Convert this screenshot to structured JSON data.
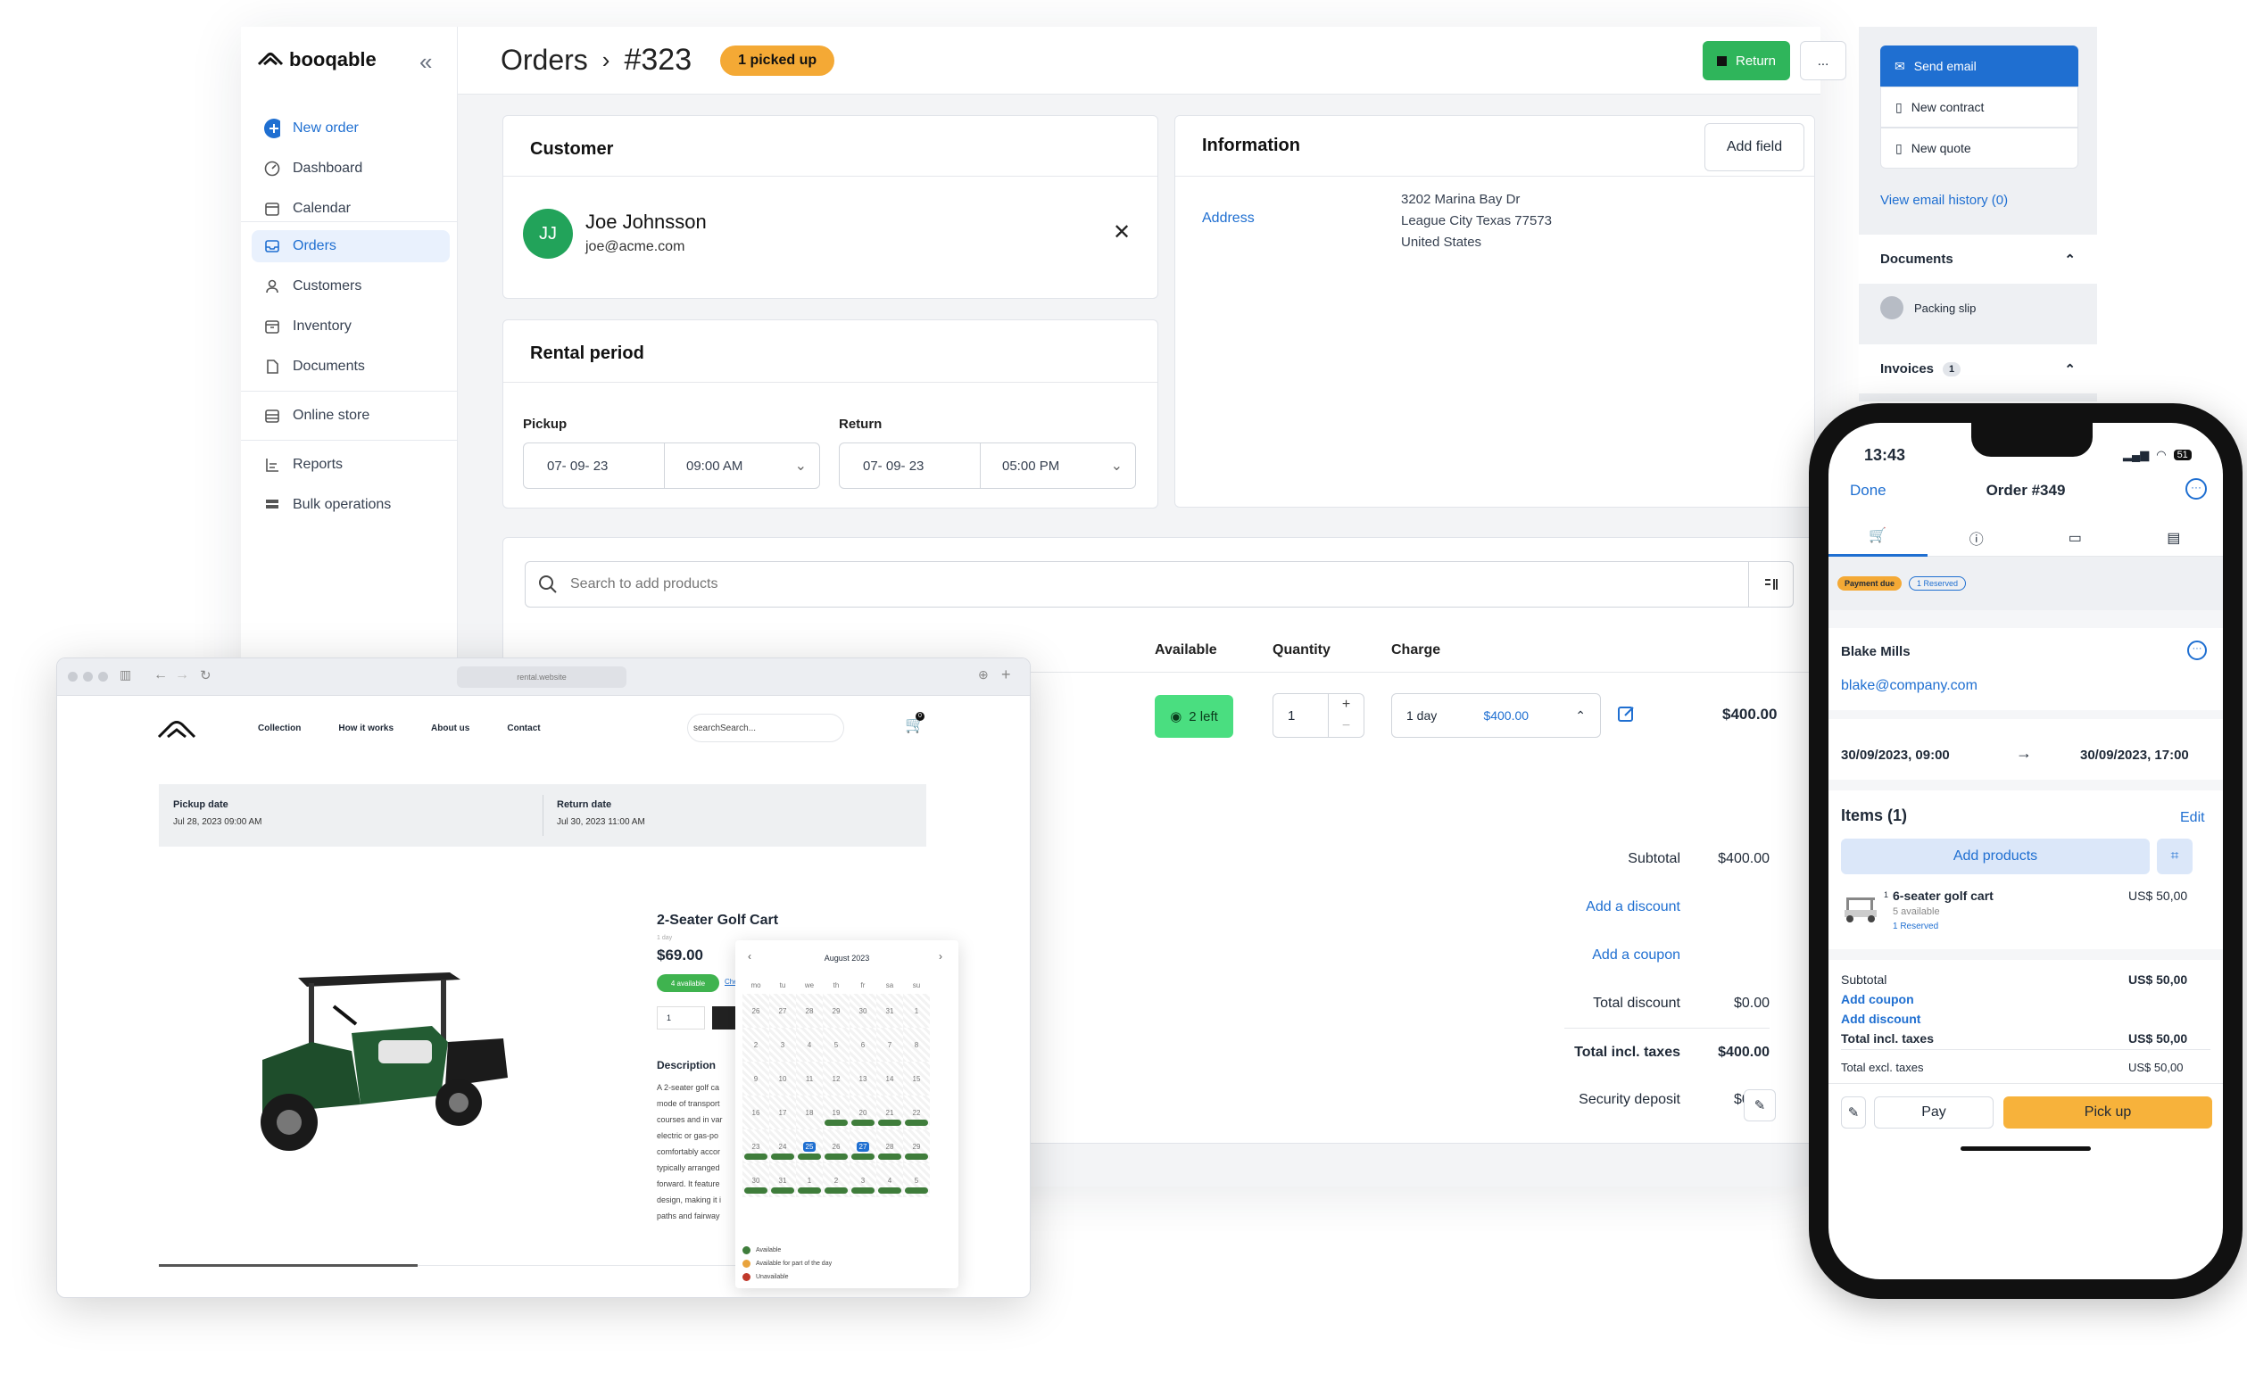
{
  "app": {
    "logo": "booqable",
    "nav": {
      "new_order": "New order",
      "dashboard": "Dashboard",
      "calendar": "Calendar",
      "orders": "Orders",
      "customers": "Customers",
      "inventory": "Inventory",
      "documents": "Documents",
      "online_store": "Online store",
      "reports": "Reports",
      "bulk_operations": "Bulk operations"
    },
    "header": {
      "title": "Orders",
      "order_number": "#323",
      "status_badge": "1 picked up",
      "return_button": "Return",
      "more_button": "..."
    },
    "customer": {
      "heading": "Customer",
      "initials": "JJ",
      "name": "Joe Johnsson",
      "email": "joe@acme.com"
    },
    "information": {
      "heading": "Information",
      "add_field": "Add field",
      "address_label": "Address",
      "address_line1": "3202 Marina Bay Dr",
      "address_line2": "League City Texas 77573",
      "address_line3": "United States"
    },
    "rental_period": {
      "heading": "Rental period",
      "pickup_label": "Pickup",
      "pickup_date": "07- 09- 23",
      "pickup_time": "09:00 AM",
      "return_label": "Return",
      "return_date": "07- 09- 23",
      "return_time": "05:00 PM"
    },
    "products": {
      "search_placeholder": "Search to add products",
      "col_available": "Available",
      "col_quantity": "Quantity",
      "col_charge": "Charge",
      "row": {
        "available": "2 left",
        "quantity": "1",
        "charge_period": "1 day",
        "charge_price": "$400.00",
        "total": "$400.00"
      }
    },
    "totals": {
      "subtotal_label": "Subtotal",
      "subtotal": "$400.00",
      "add_discount": "Add a discount",
      "add_coupon": "Add a coupon",
      "total_discount_label": "Total discount",
      "total_discount": "$0.00",
      "total_incl_label": "Total incl. taxes",
      "total_incl": "$400.00",
      "deposit_label": "Security deposit",
      "deposit": "$0.00"
    },
    "right_panel": {
      "send_email": "Send email",
      "new_contract": "New contract",
      "new_quote": "New quote",
      "email_history": "View email history (0)",
      "documents": "Documents",
      "packing_slip": "Packing slip",
      "invoices": "Invoices",
      "invoices_count": "1"
    }
  },
  "browser": {
    "url": "rental.website",
    "nav": [
      "Collection",
      "How it works",
      "About us",
      "Contact"
    ],
    "search_placeholder": "searchSearch...",
    "cart_count": "0",
    "pickup_label": "Pickup date",
    "pickup_value": "Jul 28, 2023 09:00 AM",
    "return_label": "Return date",
    "return_value": "Jul 30, 2023 11:00 AM",
    "product_title": "2-Seater Golf Cart",
    "price_period": "1 day",
    "price": "$69.00",
    "available_badge": "4 available",
    "check_link": "Che",
    "qty": "1",
    "description_heading": "Description",
    "description_lines": [
      "A 2-seater golf ca",
      "mode of transport",
      "courses and in var",
      "electric or gas-po",
      "comfortably accor",
      "typically arranged",
      "forward. It feature",
      "design, making it i",
      "paths and fairway"
    ],
    "calendar": {
      "month": "August 2023",
      "weekdays": [
        "mo",
        "tu",
        "we",
        "th",
        "fr",
        "sa",
        "su"
      ],
      "weeks": [
        [
          "26",
          "27",
          "28",
          "29",
          "30",
          "31",
          "1"
        ],
        [
          "2",
          "3",
          "4",
          "5",
          "6",
          "7",
          "8"
        ],
        [
          "9",
          "10",
          "11",
          "12",
          "13",
          "14",
          "15"
        ],
        [
          "16",
          "17",
          "18",
          "19",
          "20",
          "21",
          "22"
        ],
        [
          "23",
          "24",
          "25",
          "26",
          "27",
          "28",
          "29"
        ],
        [
          "30",
          "31",
          "1",
          "2",
          "3",
          "4",
          "5"
        ]
      ],
      "legend": [
        "Available",
        "Available for part of the day",
        "Unavailable"
      ],
      "colors": {
        "available": "#3f7d3b",
        "partial": "#e8a33d",
        "unavailable": "#c0392b"
      }
    }
  },
  "phone": {
    "time": "13:43",
    "battery": "51",
    "done": "Done",
    "title": "Order #349",
    "badge_payment": "Payment due",
    "badge_reserved": "1 Reserved",
    "customer_name": "Blake Mills",
    "customer_email": "blake@company.com",
    "start": "30/09/2023, 09:00",
    "end": "30/09/2023, 17:00",
    "items_heading": "Items  (1)",
    "edit": "Edit",
    "add_products": "Add products",
    "item_qty": "1",
    "item_name": "6-seater golf cart",
    "item_available": "5 available",
    "item_reserved": "1 Reserved",
    "item_price": "US$ 50,00",
    "subtotal_label": "Subtotal",
    "subtotal": "US$ 50,00",
    "add_coupon": "Add coupon",
    "add_discount": "Add discount",
    "total_incl_label": "Total incl. taxes",
    "total_incl": "US$ 50,00",
    "total_excl_label": "Total excl. taxes",
    "total_excl": "US$ 50,00",
    "pay": "Pay",
    "pickup": "Pick up"
  }
}
